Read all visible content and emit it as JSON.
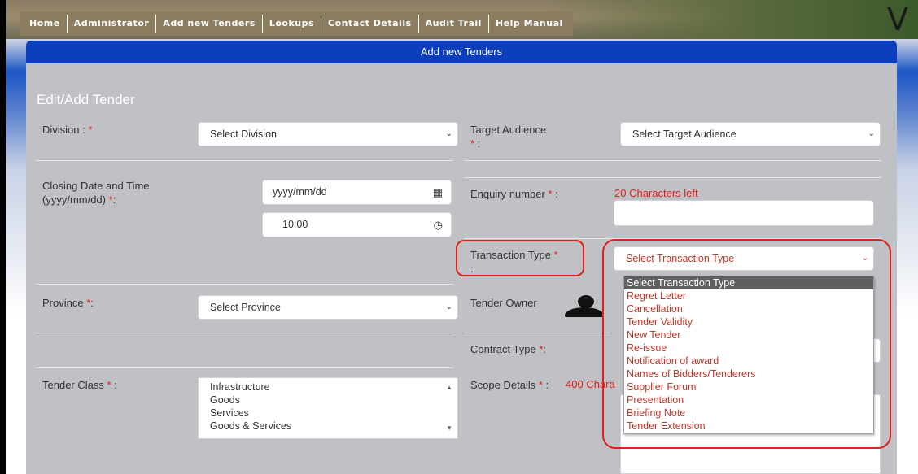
{
  "menu": [
    "Home",
    "Administrator",
    "Add new Tenders",
    "Lookups",
    "Contact Details",
    "Audit Trail",
    "Help Manual"
  ],
  "header": {
    "logo_glyph": "V",
    "panel_title": "Add new Tenders"
  },
  "form": {
    "title": "Edit/Add Tender",
    "required_mark": "*",
    "division": {
      "label": "Division : ",
      "suffix": "",
      "select": "Select Division"
    },
    "target_audience": {
      "label": "Target Audience",
      "suffix": " :",
      "select": "Select Target Audience"
    },
    "closing_date": {
      "label": "Closing Date and Time (yyyy/mm/dd) ",
      "suffix": ":",
      "date_value": "yyyy/mm/dd",
      "time_value": "10:00"
    },
    "enquiry_number": {
      "label": "Enquiry number ",
      "suffix": " :",
      "counter": "20 Characters left",
      "value": ""
    },
    "transaction_type": {
      "label": "Transaction Type ",
      "suffix": ":",
      "select": "Select Transaction Type",
      "options": [
        "Select Transaction Type",
        "Regret Letter",
        "Cancellation",
        "Tender Validity",
        "New Tender",
        "Re-issue",
        "Notification of award",
        "Names of Bidders/Tenderers",
        "Supplier Forum",
        "Presentation",
        "Briefing Note",
        "Tender Extension"
      ]
    },
    "province": {
      "label": "Province ",
      "suffix": ":",
      "select": "Select Province"
    },
    "tender_owner": {
      "label": "Tender Owner"
    },
    "contract_type": {
      "label": "Contract Type ",
      "suffix": ":"
    },
    "tender_class": {
      "label": "Tender Class ",
      "suffix": " :",
      "options": [
        "Infrastructure",
        "Goods",
        "Services",
        "Goods & Services"
      ]
    },
    "scope_details": {
      "label": "Scope Details ",
      "suffix": " :",
      "counter": "400 Chara"
    }
  },
  "colors": {
    "accent": "#0b3ebd",
    "required": "#e0201b",
    "annotation": "#e0201b",
    "option_text": "#c0392b"
  },
  "icons": {
    "calendar": "calendar-icon",
    "clock": "clock-icon",
    "chevron": "chevron-down-icon",
    "user": "user-group-icon"
  }
}
